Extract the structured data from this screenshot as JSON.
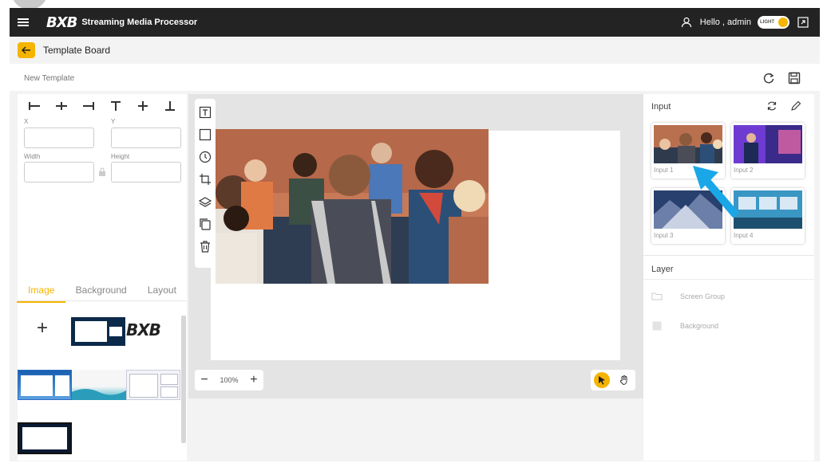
{
  "header": {
    "logo": "BXB",
    "app_title": "Streaming Media Processor",
    "greeting": "Hello , admin",
    "theme_toggle_label": "LIGHT"
  },
  "breadcrumb": {
    "title": "Template Board"
  },
  "template": {
    "name_placeholder": "New Template"
  },
  "properties": {
    "x_label": "X",
    "y_label": "Y",
    "width_label": "Width",
    "height_label": "Height"
  },
  "left_tabs": [
    {
      "label": "Image",
      "active": true
    },
    {
      "label": "Background",
      "active": false
    },
    {
      "label": "Layout",
      "active": false
    }
  ],
  "image_library": {
    "add_symbol": "+",
    "logo_thumb_text": "BXB"
  },
  "zoom": {
    "minus": "−",
    "level": "100%",
    "plus": "+"
  },
  "inputs": {
    "title": "Input",
    "items": [
      {
        "label": "Input 1"
      },
      {
        "label": "Input 2"
      },
      {
        "label": "Input 3"
      },
      {
        "label": "Input 4"
      }
    ]
  },
  "layers": {
    "title": "Layer",
    "items": [
      {
        "label": "Screen Group",
        "icon": "folder-icon"
      },
      {
        "label": "Background",
        "icon": "square-icon"
      }
    ]
  },
  "colors": {
    "accent": "#f5b400",
    "topbar": "#232323",
    "arrow": "#1aa7e8"
  }
}
